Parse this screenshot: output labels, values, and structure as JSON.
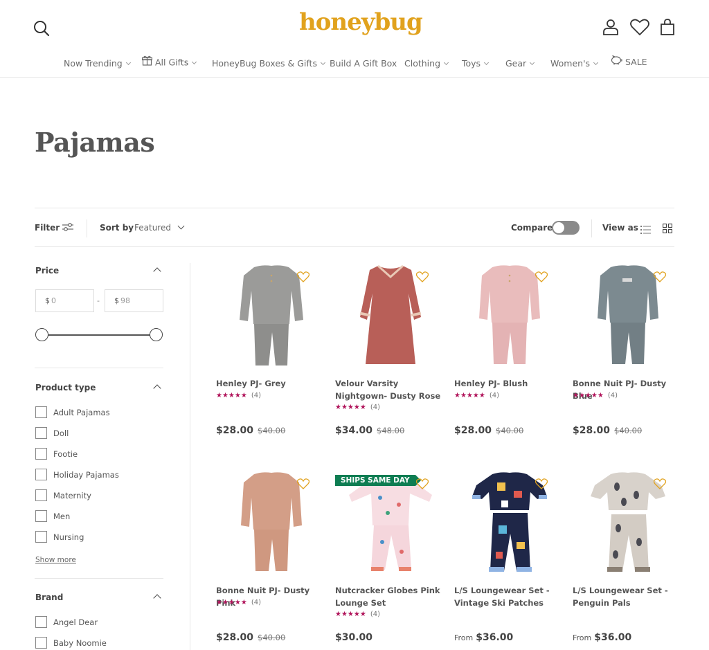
{
  "header": {
    "logo_text": "honeybug",
    "logo_color": "#e1a21d",
    "icons": [
      "search-icon",
      "account-icon",
      "heart-icon",
      "bag-icon"
    ]
  },
  "nav": [
    {
      "label": "Now Trending",
      "chevron": true
    },
    {
      "label": "All Gifts",
      "chevron": true,
      "icon": "gift-icon"
    },
    {
      "label": "HoneyBug Boxes & Gifts",
      "chevron": true
    },
    {
      "label": "Build A Gift Box",
      "chevron": false
    },
    {
      "label": "Clothing",
      "chevron": true
    },
    {
      "label": "Toys",
      "chevron": true
    },
    {
      "label": "Gear",
      "chevron": true
    },
    {
      "label": "Women's",
      "chevron": true
    },
    {
      "label": "SALE",
      "chevron": false,
      "icon": "piggy-bank-icon"
    }
  ],
  "page": {
    "title": "Pajamas"
  },
  "toolbar": {
    "filter_label": "Filter",
    "sort_label": "Sort by",
    "sort_value": "Featured",
    "compare_label": "Compare",
    "compare_on": false,
    "view_as_label": "View as",
    "view_mode": "grid"
  },
  "facets": {
    "price": {
      "title": "Price",
      "currency": "$",
      "min_placeholder": "0",
      "max_placeholder": "98",
      "separator": "-"
    },
    "product_type": {
      "title": "Product type",
      "options": [
        "Adult Pajamas",
        "Doll",
        "Footie",
        "Holiday Pajamas",
        "Maternity",
        "Men",
        "Nursing"
      ],
      "show_more": "Show more"
    },
    "brand": {
      "title": "Brand",
      "options": [
        "Angel Dear",
        "Baby Noomie"
      ]
    }
  },
  "products": [
    {
      "name": "Henley PJ- Grey",
      "rating_count": "(4)",
      "price": "$28.00",
      "compare_at": "$40.00",
      "from": "",
      "badge": "",
      "stars": "★★★★★",
      "image": "grey-henley-pajama-set"
    },
    {
      "name": "Velour Varsity Nightgown- Dusty Rose",
      "rating_count": "(4)",
      "price": "$34.00",
      "compare_at": "$48.00",
      "from": "",
      "badge": "",
      "stars": "★★★★★",
      "image": "rose-velour-nightgown"
    },
    {
      "name": "Henley PJ- Blush",
      "rating_count": "(4)",
      "price": "$28.00",
      "compare_at": "$40.00",
      "from": "",
      "badge": "",
      "stars": "★★★★★",
      "image": "blush-henley-pajama-set"
    },
    {
      "name": "Bonne Nuit PJ- Dusty Blue",
      "rating_count": "(4)",
      "price": "$28.00",
      "compare_at": "$40.00",
      "from": "",
      "badge": "",
      "stars": "★★★★★",
      "image": "dusty-blue-pajama-set"
    },
    {
      "name": "Bonne Nuit PJ- Dusty Pink",
      "rating_count": "(4)",
      "price": "$28.00",
      "compare_at": "$40.00",
      "from": "",
      "badge": "",
      "stars": "★★★★★",
      "image": "dusty-pink-pajama-set"
    },
    {
      "name": "Nutcracker Globes Pink Lounge Set",
      "rating_count": "(4)",
      "price": "$30.00",
      "compare_at": "",
      "from": "",
      "badge": "SHIPS SAME DAY",
      "stars": "★★★★★",
      "image": "nutcracker-pink-lounge-set"
    },
    {
      "name": "L/S Loungewear Set - Vintage Ski Patches",
      "rating_count": "",
      "price": "$36.00",
      "compare_at": "",
      "from": "From",
      "badge": "",
      "stars": "",
      "image": "navy-ski-patches-set"
    },
    {
      "name": "L/S Loungewear Set - Penguin Pals",
      "rating_count": "",
      "price": "$36.00",
      "compare_at": "",
      "from": "From",
      "badge": "",
      "stars": "",
      "image": "penguin-print-set"
    }
  ],
  "colors": {
    "accent_gold": "#e1a21d",
    "star_magenta": "#b0135a",
    "badge_green": "#0e7d52",
    "text_dark": "#444444"
  }
}
